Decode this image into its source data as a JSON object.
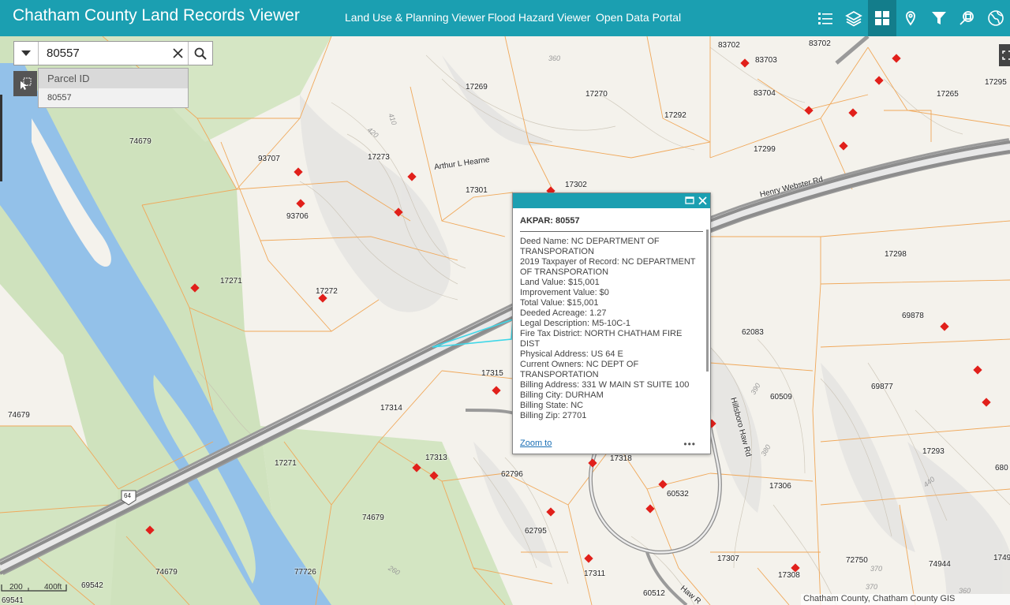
{
  "header": {
    "title": "Chatham County Land Records Viewer",
    "links": [
      "Land Use & Planning Viewer",
      "Flood Hazard Viewer",
      "Open Data Portal"
    ],
    "tools": [
      "list-icon",
      "layers-icon",
      "basemap-gallery-icon",
      "location-pin-icon",
      "filter-icon",
      "parcel-search-icon",
      "globe-icon"
    ],
    "accent_color": "#1b9fb1"
  },
  "search": {
    "value": "80557",
    "suggestion_group": "Parcel ID",
    "suggestion_item": "80557"
  },
  "map": {
    "parcel_labels": [
      "83702",
      "83703",
      "83702",
      "17269",
      "17270",
      "17292",
      "83704",
      "17265",
      "17295",
      "74679",
      "93707",
      "17273",
      "17301",
      "17302",
      "17299",
      "93706",
      "17271",
      "17272",
      "17298",
      "69878",
      "62083",
      "74679",
      "17315",
      "17314",
      "60509",
      "69877",
      "17313",
      "17271",
      "62796",
      "17318",
      "17293",
      "60532",
      "17306",
      "74679",
      "62795",
      "77726",
      "74679",
      "69542",
      "17311",
      "17307",
      "72750",
      "74944",
      "17308",
      "60512",
      "69541",
      "680",
      "1749"
    ],
    "road_labels": [
      "Henry Webster Rd",
      "Arthur L Hearne",
      "Hillsboro Haw Rd",
      "Haw R",
      "64"
    ],
    "contour_labels": [
      "360",
      "410",
      "420",
      "390",
      "380",
      "440",
      "370",
      "260",
      "360",
      "370"
    ]
  },
  "popup": {
    "title": "AKPAR: 80557",
    "fields": [
      "Deed Name:  NC DEPARTMENT OF TRANSPORATION",
      "2019 Taxpayer of Record:  NC DEPARTMENT OF TRANSPORATION",
      "Land Value:  $15,001",
      "Improvement Value:  $0",
      "Total Value:  $15,001",
      "Deeded Acreage: 1.27",
      "Legal Description:  M5-10C-1",
      "Fire Tax District:  NORTH CHATHAM FIRE DIST",
      "Physical Address:  US 64 E",
      "Current Owners:  NC DEPT OF TRANSPORTATION",
      "Billing Address:  331 W MAIN ST SUITE 100",
      "Billing City:  DURHAM",
      "Billing State:  NC",
      "Billing Zip:  27701"
    ],
    "zoom_link": "Zoom to",
    "more": "•••"
  },
  "scale": {
    "label_200": "200",
    "label_400": "400ft"
  },
  "attribution": "Chatham County, Chatham County GIS"
}
